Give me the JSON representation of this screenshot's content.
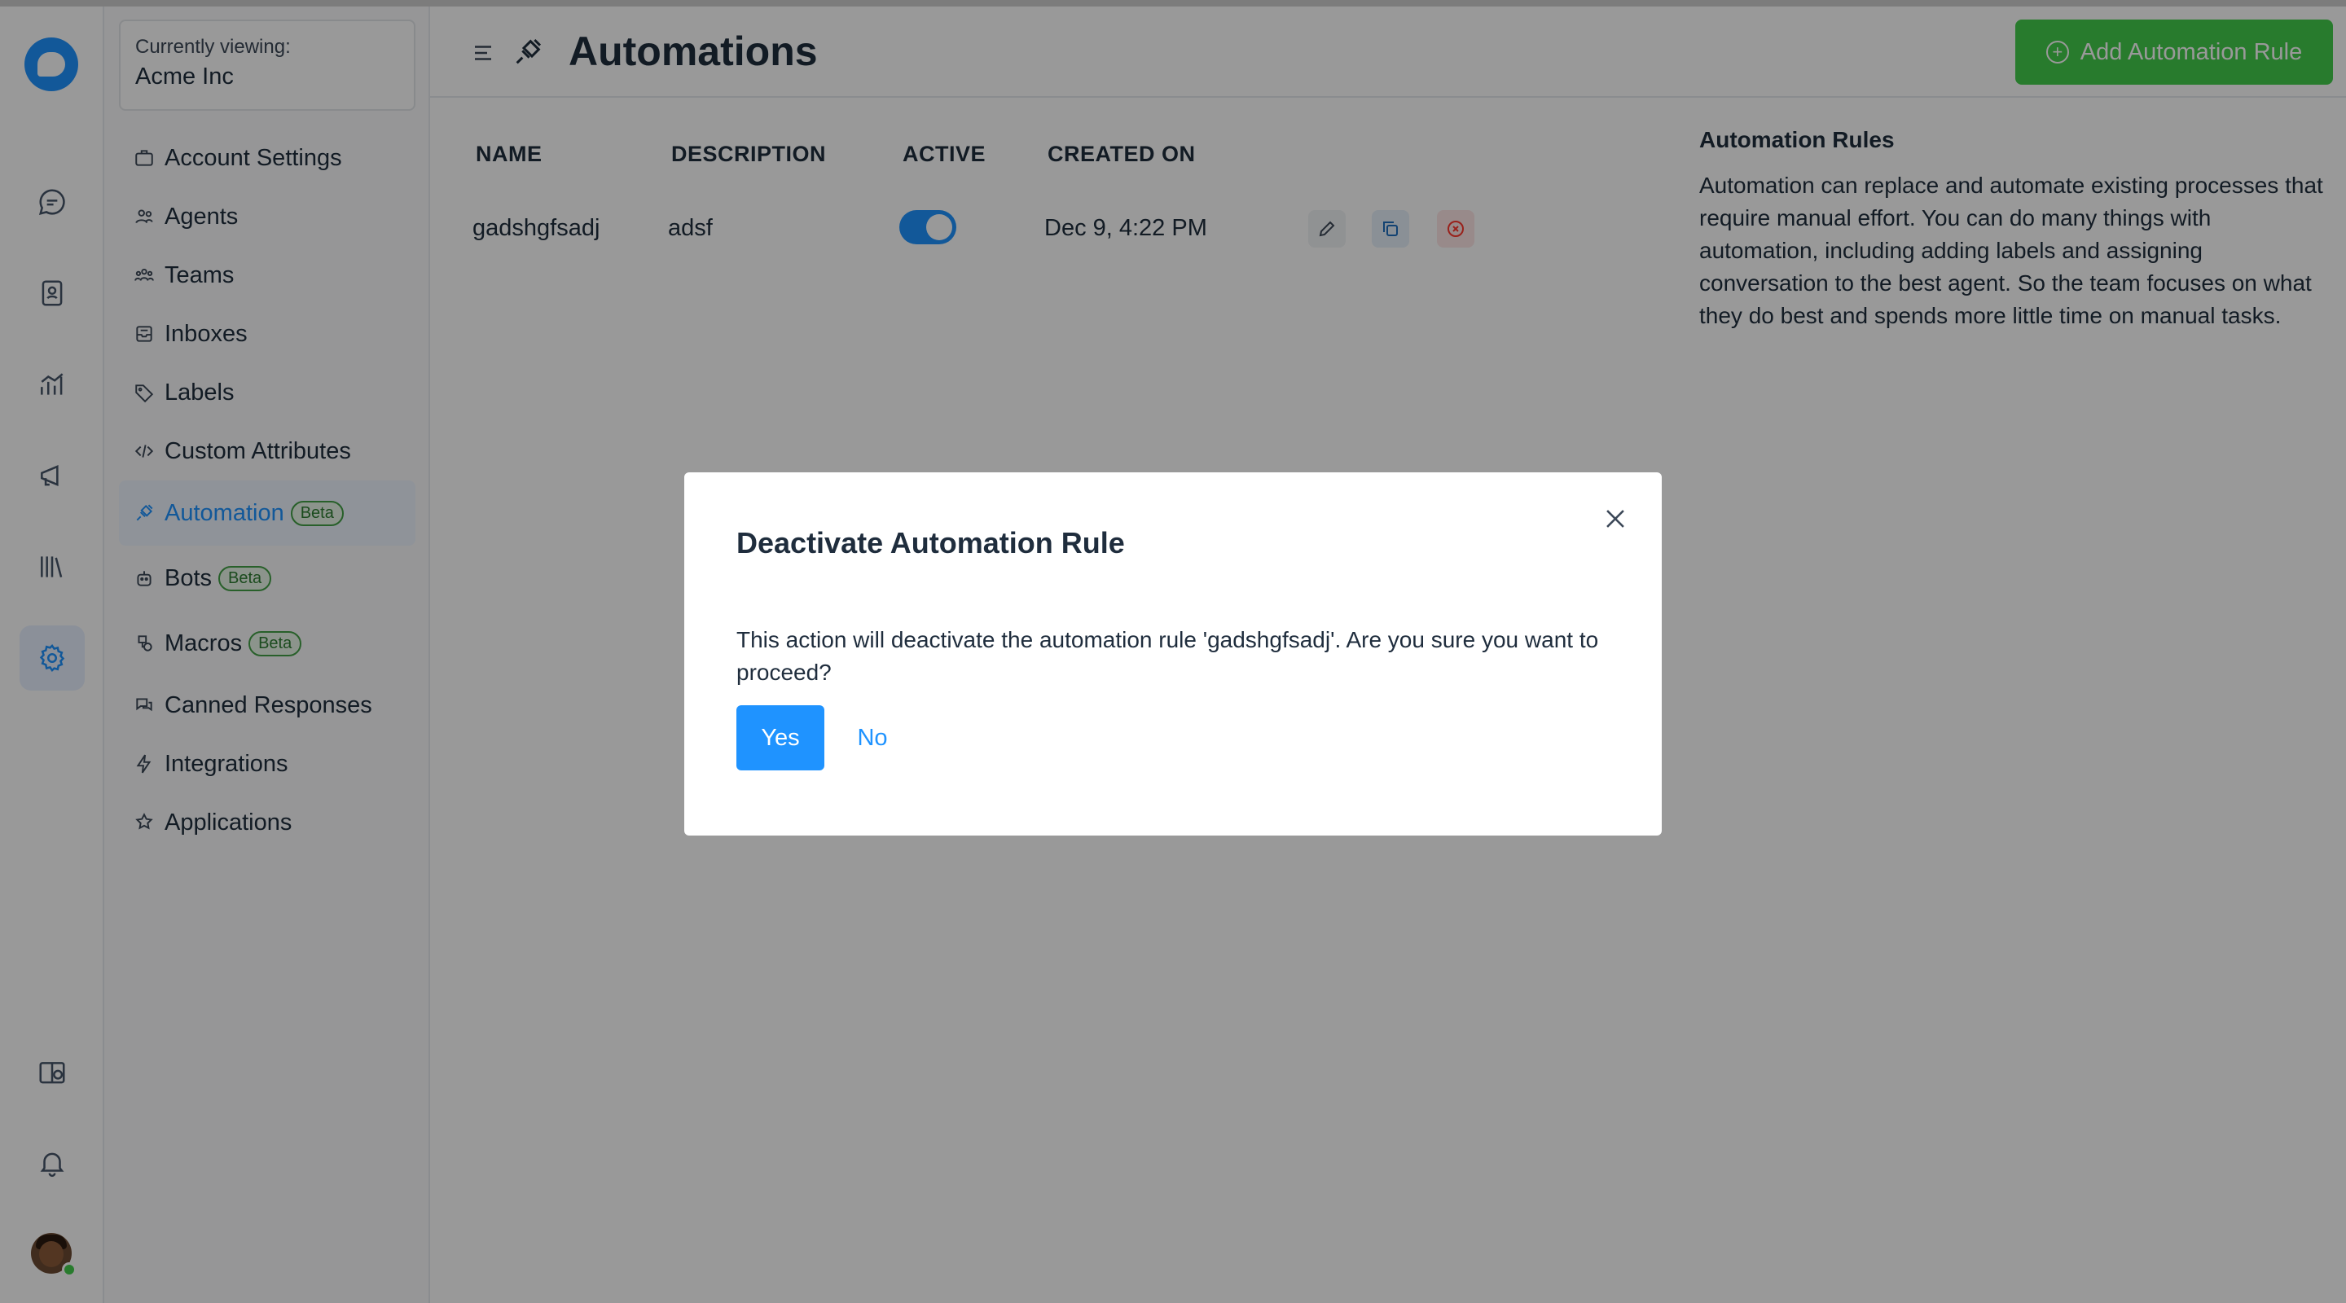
{
  "account": {
    "label": "Currently viewing:",
    "name": "Acme Inc"
  },
  "sidebar": {
    "items": [
      {
        "label": "Account Settings",
        "icon": "briefcase-icon"
      },
      {
        "label": "Agents",
        "icon": "people-icon"
      },
      {
        "label": "Teams",
        "icon": "team-icon"
      },
      {
        "label": "Inboxes",
        "icon": "inbox-icon"
      },
      {
        "label": "Labels",
        "icon": "tag-icon"
      },
      {
        "label": "Custom Attributes",
        "icon": "code-icon"
      },
      {
        "label": "Automation",
        "icon": "automation-icon",
        "badge": "Beta",
        "active": true
      },
      {
        "label": "Bots",
        "icon": "bot-icon",
        "badge": "Beta"
      },
      {
        "label": "Macros",
        "icon": "macro-icon",
        "badge": "Beta"
      },
      {
        "label": "Canned Responses",
        "icon": "chat-bubbles-icon"
      },
      {
        "label": "Integrations",
        "icon": "flash-icon"
      },
      {
        "label": "Applications",
        "icon": "apps-icon"
      }
    ]
  },
  "rail": {
    "icons": [
      "conversations-icon",
      "contacts-icon",
      "reports-icon",
      "campaigns-icon",
      "library-icon",
      "settings-icon",
      "help-center-icon",
      "notifications-icon"
    ]
  },
  "header": {
    "title": "Automations",
    "add_button": "Add Automation Rule"
  },
  "table": {
    "columns": [
      "NAME",
      "DESCRIPTION",
      "ACTIVE",
      "CREATED ON"
    ],
    "rows": [
      {
        "name": "gadshgfsadj",
        "description": "adsf",
        "active": true,
        "created_on": "Dec 9, 4:22 PM"
      }
    ]
  },
  "info": {
    "title": "Automation Rules",
    "body": "Automation can replace and automate existing processes that require manual effort. You can do many things with automation, including adding labels and assigning conversation to the best agent. So the team focuses on what they do best and spends more little time on manual tasks."
  },
  "modal": {
    "title": "Deactivate Automation Rule",
    "message": "This action will deactivate the automation rule 'gadshgfsadj'. Are you sure you want to proceed?",
    "yes_label": "Yes",
    "no_label": "No"
  },
  "colors": {
    "brand": "#1f93ff",
    "success": "#44ce4b",
    "danger": "#ff382d"
  }
}
